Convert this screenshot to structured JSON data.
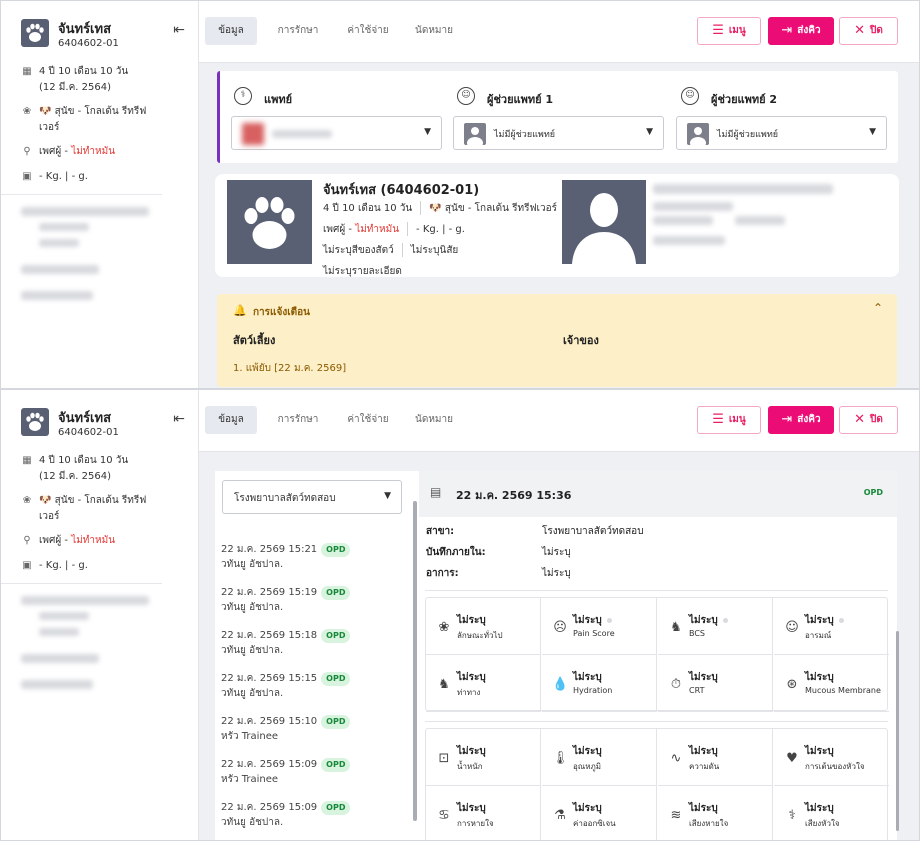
{
  "pet": {
    "name": "จันทร์เทส",
    "code": "6404602-01",
    "age": "4 ปี 10 เดือน 10 วัน",
    "birth": "(12 มี.ค. 2564)",
    "breed_prefix": "สุนัข - ",
    "breed": "โกลเด้น รีทรีฟเวอร์",
    "breed_l1": "สุนัข - โกลเด้น รีทรีฟ",
    "breed_l2": "เวอร์",
    "sex_prefix": "เพศผู้ - ",
    "sterile": "ไม่ทำหมัน",
    "weight": "- Kg. | - g.",
    "full_title": "จันทร์เทส (6404602-01)",
    "color": "ไม่ระบุสีของสัตว์",
    "temper": "ไม่ระบุนิสัย",
    "detail": "ไม่ระบุรายละเอียด"
  },
  "tabs": [
    "ข้อมูล",
    "การรักษา",
    "ค่าใช้จ่าย",
    "นัดหมาย"
  ],
  "buttons": {
    "menu": "เมนู",
    "send": "ส่งคิว",
    "close": "ปิด"
  },
  "doctors": {
    "doctor_label": "แพทย์",
    "assist1_label": "ผู้ช่วยแพทย์ 1",
    "assist2_label": "ผู้ช่วยแพทย์ 2",
    "assist_value": "ไม่มีผู้ช่วยแพทย์"
  },
  "alert": {
    "title": "การแจ้งเตือน",
    "col_pet": "สัตว์เลี้ยง",
    "col_owner": "เจ้าของ",
    "item": "1. แพ้ยับ [22 ม.ค. 2569]"
  },
  "history": {
    "hospital": "โรงพยาบาลสัตว์ทดสอบ",
    "items": [
      {
        "date": "22 ม.ค. 2569 15:21",
        "who": "วทันยู อัชปาล.",
        "badge": "OPD"
      },
      {
        "date": "22 ม.ค. 2569 15:19",
        "who": "วทันยู อัชปาล.",
        "badge": "OPD"
      },
      {
        "date": "22 ม.ค. 2569 15:18",
        "who": "วทันยู อัชปาล.",
        "badge": "OPD"
      },
      {
        "date": "22 ม.ค. 2569 15:15",
        "who": "วทันยู อัชปาล.",
        "badge": "OPD"
      },
      {
        "date": "22 ม.ค. 2569 15:10",
        "who": "หรัว Trainee",
        "badge": "OPD"
      },
      {
        "date": "22 ม.ค. 2569 15:09",
        "who": "หรัว Trainee",
        "badge": "OPD"
      },
      {
        "date": "22 ม.ค. 2569 15:09",
        "who": "วทันยู อัชปาล.",
        "badge": "OPD"
      }
    ]
  },
  "visit": {
    "datetime": "22 ม.ค. 2569 15:36",
    "badge": "OPD",
    "branch_label": "สาขา:",
    "branch_value": "โรงพยาบาลสัตว์ทดสอบ",
    "note_label": "บันทึกภายใน:",
    "note_value": "ไม่ระบุ",
    "symptom_label": "อาการ:",
    "symptom_value": "ไม่ระบุ"
  },
  "grid1": [
    {
      "value": "ไม่ระบุ",
      "label": "ลักษณะทั่วไป",
      "icon": "paw-icon"
    },
    {
      "value": "ไม่ระบุ",
      "label": "Pain Score",
      "icon": "pain-face-icon"
    },
    {
      "value": "ไม่ระบุ",
      "label": "BCS",
      "icon": "dog-body-icon"
    },
    {
      "value": "ไม่ระบุ",
      "label": "อารมณ์",
      "icon": "smile-icon"
    },
    {
      "value": "ไม่ระบุ",
      "label": "ท่าทาง",
      "icon": "dog-posture-icon"
    },
    {
      "value": "ไม่ระบุ",
      "label": "Hydration",
      "icon": "water-drop-icon"
    },
    {
      "value": "ไม่ระบุ",
      "label": "CRT",
      "icon": "stopwatch-icon"
    },
    {
      "value": "ไม่ระบุ",
      "label": "Mucous Membrane",
      "icon": "cells-icon"
    }
  ],
  "grid2": [
    {
      "value": "ไม่ระบุ",
      "label": "น้ำหนัก",
      "icon": "scale-icon"
    },
    {
      "value": "ไม่ระบุ",
      "label": "อุณหภูมิ",
      "icon": "thermometer-icon"
    },
    {
      "value": "ไม่ระบุ",
      "label": "ความดัน",
      "icon": "pulse-wave-icon"
    },
    {
      "value": "ไม่ระบุ",
      "label": "การเต้นของหัวใจ",
      "icon": "heartbeat-icon"
    },
    {
      "value": "ไม่ระบุ",
      "label": "การหายใจ",
      "icon": "lungs-icon"
    },
    {
      "value": "ไม่ระบุ",
      "label": "ค่าออกซิเจน",
      "icon": "oxygen-drop-icon"
    },
    {
      "value": "ไม่ระบุ",
      "label": "เสียงหายใจ",
      "icon": "breath-sound-icon"
    },
    {
      "value": "ไม่ระบุ",
      "label": "เสียงหัวใจ",
      "icon": "stethoscope-icon"
    }
  ],
  "colors": {
    "accent": "#ec0c75",
    "sterile": "#e53935",
    "doctor_bar": "#7b2fbe",
    "alert_bg": "#fdefc7",
    "opd_bg": "#d8f3de",
    "avatar_bg": "#5a6074"
  }
}
